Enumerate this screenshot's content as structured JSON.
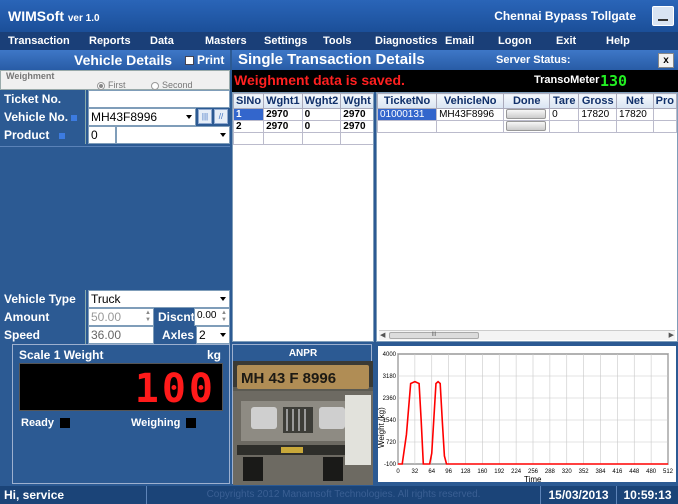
{
  "window": {
    "app_name": "WIMSoft",
    "version": "ver 1.0",
    "location": "Chennai Bypass Tollgate"
  },
  "menu": [
    "Transaction",
    "Reports",
    "Data",
    "Masters",
    "Settings",
    "Tools",
    "Diagnostics",
    "Email",
    "Logon",
    "Exit",
    "Help"
  ],
  "vehicle_details": {
    "title": "Vehicle Details",
    "print_label": "Print",
    "weighment_label": "Weighment",
    "first_label": "First",
    "second_label": "Second",
    "selected_weighment": "First",
    "ticket_no_label": "Ticket No.",
    "ticket_no_value": "",
    "vehicle_no_label": "Vehicle No.",
    "vehicle_no_value": "MH43F8996",
    "product_label": "Product",
    "product_value": "0",
    "vehicle_type_label": "Vehicle Type",
    "vehicle_type_value": "Truck",
    "amount_label": "Amount",
    "amount_value": "50.00",
    "discount_label": "Discnt",
    "discount_value": "0.00",
    "speed_label": "Speed",
    "speed_value": "36.00",
    "axles_label": "Axles",
    "axles_value": "2"
  },
  "scale": {
    "title": "Scale 1 Weight",
    "unit": "kg",
    "weight": "100",
    "ready_label": "Ready",
    "weighing_label": "Weighing"
  },
  "transaction": {
    "title": "Single Transaction Details",
    "server_status_label": "Server Status:",
    "close_label": "x",
    "message": "Weighment data is saved.",
    "transometer_label": "TransoMeter",
    "transometer_value": "130"
  },
  "axle_table": {
    "headers": [
      "SlNo",
      "Wght1",
      "Wght2",
      "Wght"
    ],
    "rows": [
      [
        "1",
        "2970",
        "0",
        "2970"
      ],
      [
        "2",
        "2970",
        "0",
        "2970"
      ]
    ]
  },
  "ticket_table": {
    "headers": [
      "TicketNo",
      "VehicleNo",
      "Done",
      "Tare",
      "Gross",
      "Net",
      "Pro"
    ],
    "rows": [
      [
        "01000131",
        "MH43F8996",
        "",
        "0",
        "17820",
        "17820",
        ""
      ]
    ]
  },
  "anpr": {
    "title": "ANPR",
    "plate_text": "MH 43 F 8996"
  },
  "chart_data": {
    "type": "line",
    "xlabel": "Time",
    "ylabel": "Weight (kg)",
    "y_ticks": [
      4000,
      3180,
      2360,
      1540,
      720,
      -100
    ],
    "x_ticks": [
      0,
      32,
      64,
      96,
      128,
      160,
      192,
      224,
      256,
      288,
      320,
      352,
      384,
      416,
      448,
      480,
      512
    ],
    "xlim": [
      0,
      512
    ],
    "ylim": [
      -100,
      4000
    ],
    "grid": true,
    "series": [
      {
        "color": "#ff0000",
        "x": [
          0,
          8,
          16,
          24,
          32,
          40,
          44,
          48,
          52,
          56,
          60,
          64,
          68,
          72,
          76,
          80,
          84,
          88,
          92,
          96,
          100,
          104,
          512
        ],
        "y": [
          -100,
          -100,
          1000,
          2900,
          2970,
          2900,
          1500,
          -100,
          -100,
          -100,
          -100,
          300,
          1600,
          2900,
          2970,
          2900,
          1500,
          200,
          -100,
          -100,
          -100,
          -100,
          -100
        ]
      }
    ]
  },
  "status": {
    "user": "Hi, service",
    "copyright": "Copyrights 2012 Manamsoft Technologies. All rights reserved.",
    "date": "15/03/2013",
    "time": "10:59:13"
  }
}
